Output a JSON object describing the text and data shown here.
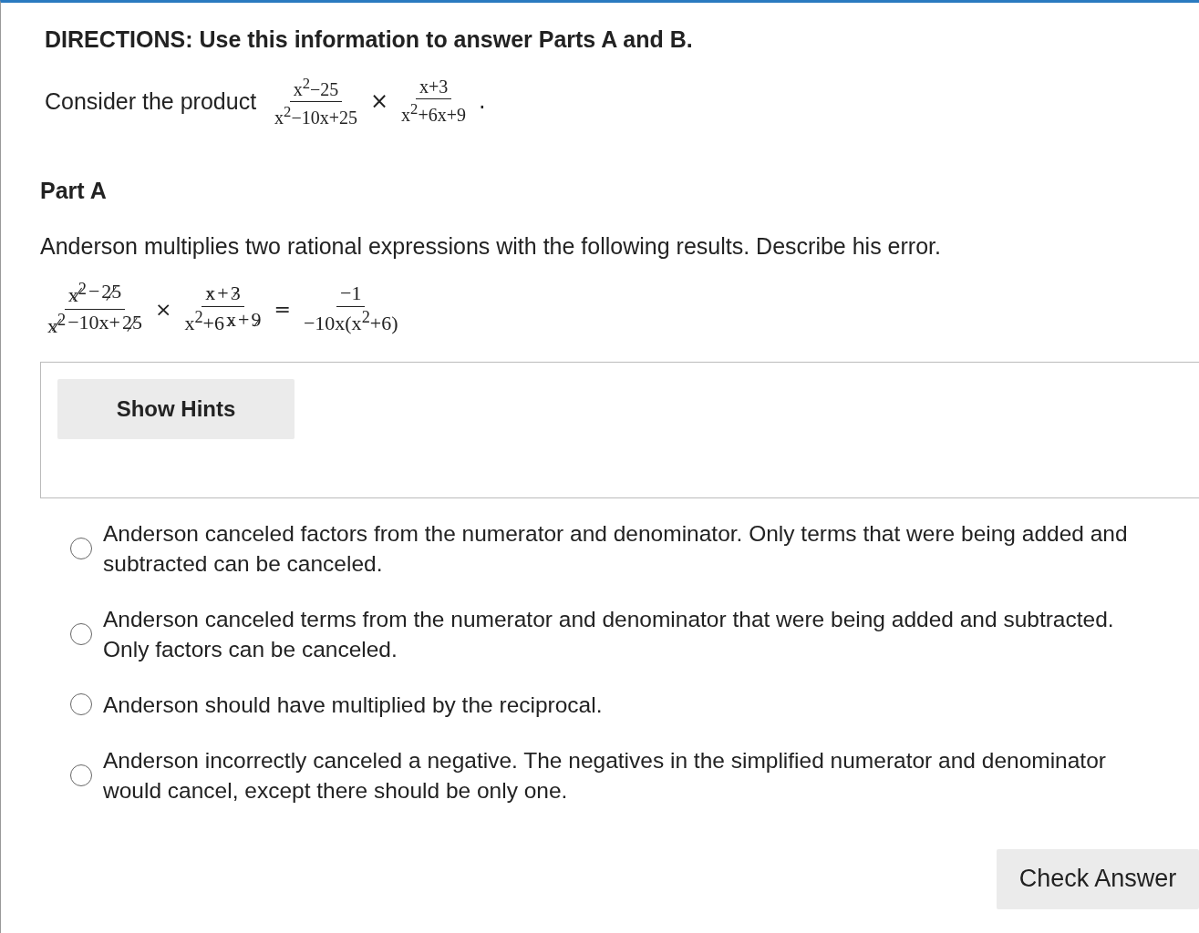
{
  "directions": "DIRECTIONS: Use this information to answer Parts A and B.",
  "product": {
    "lead": "Consider the product",
    "terms": [
      {
        "kind": "fraction",
        "numerator": [
          {
            "text": "x$^{2}$−25",
            "canceled": false
          }
        ],
        "denominator": [
          {
            "text": "x$^{2}$−10x+25",
            "canceled": false
          }
        ]
      },
      {
        "kind": "operator",
        "text": "×"
      },
      {
        "kind": "fraction",
        "numerator": [
          {
            "text": "x+3",
            "canceled": false
          }
        ],
        "denominator": [
          {
            "text": "x$^{2}$+6x+9",
            "canceled": false
          }
        ]
      },
      {
        "kind": "operator",
        "text": "."
      }
    ]
  },
  "part_title": "Part A",
  "question": "Anderson multiplies two rational expressions with the following results. Describe his error.",
  "work": {
    "terms": [
      {
        "kind": "fraction",
        "numerator": [
          {
            "text": "x$^{2}$",
            "canceled": true
          },
          {
            "text": "−",
            "canceled": false
          },
          {
            "text": "25",
            "canceled": true
          }
        ],
        "denominator": [
          {
            "text": "x$^{2}$",
            "canceled": true
          },
          {
            "text": "−10x+",
            "canceled": false
          },
          {
            "text": "25",
            "canceled": true
          }
        ]
      },
      {
        "kind": "operator",
        "text": "×"
      },
      {
        "kind": "fraction",
        "numerator": [
          {
            "text": "x",
            "canceled": true
          },
          {
            "text": "+",
            "canceled": false
          },
          {
            "text": "3",
            "canceled": true
          }
        ],
        "denominator": [
          {
            "text": "x$^{2}$+6",
            "canceled": false
          },
          {
            "text": "x",
            "canceled": true
          },
          {
            "text": "+",
            "canceled": false
          },
          {
            "text": "9",
            "canceled": true
          }
        ]
      },
      {
        "kind": "operator",
        "text": "="
      },
      {
        "kind": "fraction",
        "numerator": [
          {
            "text": "−1",
            "canceled": false
          }
        ],
        "denominator": [
          {
            "text": "−10x(x$^{2}$+6)",
            "canceled": false
          }
        ]
      }
    ]
  },
  "hints_button": "Show Hints",
  "options": [
    {
      "text": "Anderson canceled factors from the numerator and denominator. Only terms that were being added and subtracted can be canceled.",
      "selected": false
    },
    {
      "text": "Anderson canceled terms from the numerator and denominator that were being added and subtracted. Only factors can be canceled.",
      "selected": false
    },
    {
      "text": "Anderson should have multiplied by the reciprocal.",
      "selected": false
    },
    {
      "text": "Anderson incorrectly canceled a negative. The negatives in the simplified numerator and denominator would cancel, except there should be only one.",
      "selected": false
    }
  ],
  "check_button": "Check Answer"
}
